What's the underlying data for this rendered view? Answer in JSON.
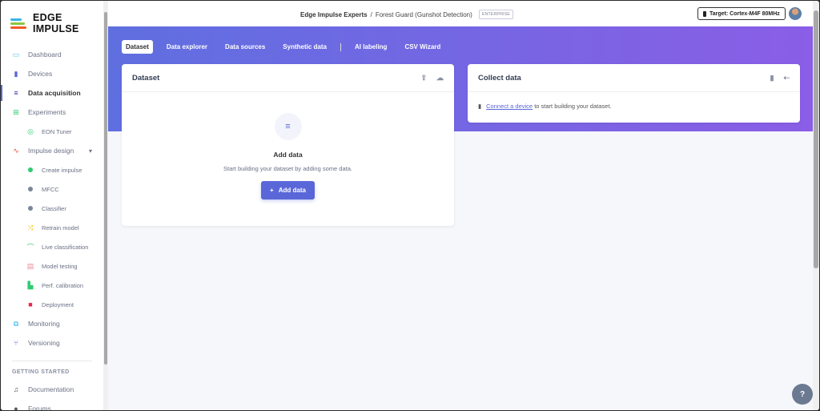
{
  "brand": {
    "name": "EDGE IMPULSE"
  },
  "sidebar": {
    "items": [
      {
        "label": "Dashboard",
        "icon": "monitor-icon",
        "color": "#4fc3e8"
      },
      {
        "label": "Devices",
        "icon": "device-icon",
        "color": "#5a67d8"
      },
      {
        "label": "Data acquisition",
        "icon": "database-icon",
        "color": "#3b2a9e"
      },
      {
        "label": "Experiments",
        "icon": "table-icon",
        "color": "#2ecc71"
      },
      {
        "label": "EON Tuner",
        "icon": "compass-icon",
        "color": "#2ecc71"
      },
      {
        "label": "Impulse design",
        "icon": "pulse-icon",
        "color": "#e74c3c"
      },
      {
        "label": "Create impulse",
        "icon": "dot-icon",
        "color": "#2ecc71"
      },
      {
        "label": "MFCC",
        "icon": "dot-icon",
        "color": "#7a869a"
      },
      {
        "label": "Classifier",
        "icon": "dot-icon",
        "color": "#7a869a"
      },
      {
        "label": "Retrain model",
        "icon": "shuffle-icon",
        "color": "#f1c40f"
      },
      {
        "label": "Live classification",
        "icon": "network-icon",
        "color": "#2ecc71"
      },
      {
        "label": "Model testing",
        "icon": "clipboard-icon",
        "color": "#f08a9a"
      },
      {
        "label": "Perf. calibration",
        "icon": "factory-icon",
        "color": "#2ecc71"
      },
      {
        "label": "Deployment",
        "icon": "box-icon",
        "color": "#e8274b"
      },
      {
        "label": "Monitoring",
        "icon": "binoculars-icon",
        "color": "#1fb5e6"
      },
      {
        "label": "Versioning",
        "icon": "branch-icon",
        "color": "#5a67d8"
      }
    ],
    "section": "GETTING STARTED",
    "extra": [
      {
        "label": "Documentation",
        "icon": "book-icon"
      },
      {
        "label": "Forums",
        "icon": "chat-icon"
      }
    ]
  },
  "header": {
    "org": "Edge Impulse Experts",
    "sep": "/",
    "project": "Forest Guard (Gunshot Detection)",
    "badge": "ENTERPRISE",
    "target": "Target: Cortex-M4F 80MHz"
  },
  "tabs": [
    "Dataset",
    "Data explorer",
    "Data sources",
    "Synthetic data",
    "AI labeling",
    "CSV Wizard"
  ],
  "dataset": {
    "title": "Dataset",
    "empty_title": "Add data",
    "empty_sub": "Start building your dataset by adding some data.",
    "button": "Add data"
  },
  "collect": {
    "title": "Collect data",
    "link": "Connect a device",
    "text": "to start building your dataset."
  },
  "help": "?",
  "colors": {
    "accent": "#5a67d8",
    "banner_start": "#5f6fe0",
    "banner_end": "#8a5ee6"
  }
}
